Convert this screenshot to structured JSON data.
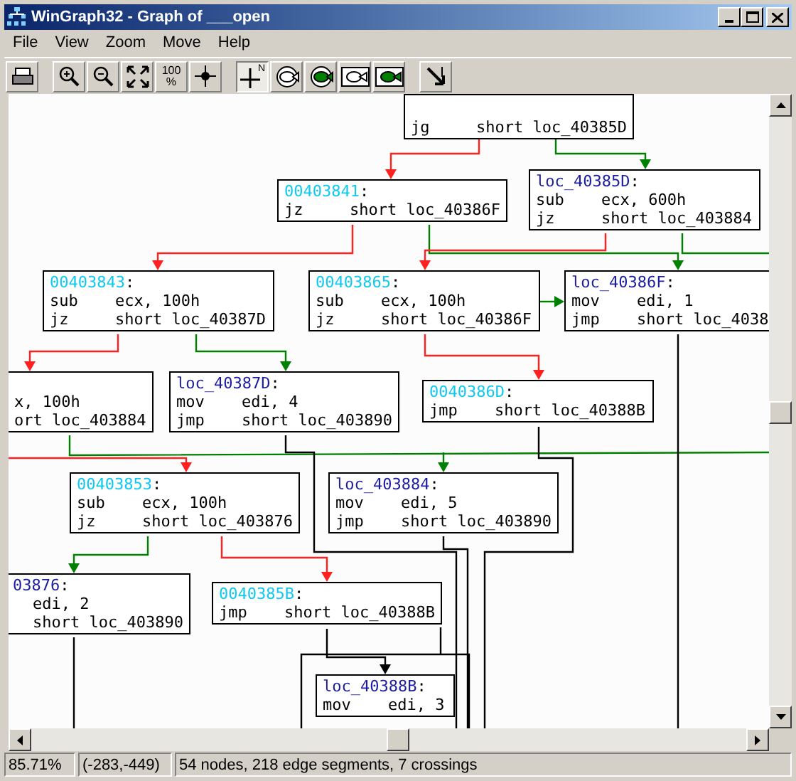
{
  "window": {
    "title": "WinGraph32 - Graph of ___open"
  },
  "menu": [
    "File",
    "View",
    "Zoom",
    "Move",
    "Help"
  ],
  "toolbar": [
    {
      "kind": "print"
    },
    {
      "kind": "sep"
    },
    {
      "kind": "zoom-in"
    },
    {
      "kind": "zoom-out"
    },
    {
      "kind": "fit"
    },
    {
      "kind": "zoom-100",
      "label": "100",
      "sub": "%"
    },
    {
      "kind": "center"
    },
    {
      "kind": "sep"
    },
    {
      "kind": "north",
      "label": "N",
      "pressed": true
    },
    {
      "kind": "fish-outline"
    },
    {
      "kind": "fish-green"
    },
    {
      "kind": "fish-outline-box"
    },
    {
      "kind": "fish-green-box"
    },
    {
      "kind": "sep"
    },
    {
      "kind": "follow"
    }
  ],
  "nodes": [
    {
      "lines": [
        {
          "op": "jg",
          "args": "short loc_40385D"
        }
      ]
    },
    {
      "header": {
        "name": "00403841",
        "punct": ":",
        "kind": "address"
      },
      "lines": [
        {
          "op": "jz",
          "args": "short loc_40386F"
        }
      ]
    },
    {
      "header": {
        "name": "loc_40385D",
        "punct": ":",
        "kind": "label"
      },
      "lines": [
        {
          "op": "sub",
          "args": "ecx, 600h"
        },
        {
          "op": "jz",
          "args": "short loc_403884"
        }
      ]
    },
    {
      "header": {
        "name": "00403843",
        "punct": ":",
        "kind": "address"
      },
      "lines": [
        {
          "op": "sub",
          "args": "ecx, 100h"
        },
        {
          "op": "jz",
          "args": "short loc_40387D"
        }
      ]
    },
    {
      "header": {
        "name": "00403865",
        "punct": ":",
        "kind": "address"
      },
      "lines": [
        {
          "op": "sub",
          "args": "ecx, 100h"
        },
        {
          "op": "jz",
          "args": "short loc_40386F"
        }
      ]
    },
    {
      "header": {
        "name": "loc_40386F",
        "punct": ":",
        "kind": "label"
      },
      "lines": [
        {
          "op": "mov",
          "args": "edi, 1"
        },
        {
          "op": "jmp",
          "args": "short loc_4038"
        }
      ]
    },
    {
      "lines": [
        {
          "args": "x, 100h"
        },
        {
          "args": "ort loc_403884"
        }
      ]
    },
    {
      "header": {
        "name": "loc_40387D",
        "punct": ":",
        "kind": "label"
      },
      "lines": [
        {
          "op": "mov",
          "args": "edi, 4"
        },
        {
          "op": "jmp",
          "args": "short loc_403890"
        }
      ]
    },
    {
      "header": {
        "name": "0040386D",
        "punct": ":",
        "kind": "address"
      },
      "lines": [
        {
          "op": "jmp",
          "args": "short loc_40388B"
        }
      ]
    },
    {
      "header": {
        "name": "00403853",
        "punct": ":",
        "kind": "address"
      },
      "lines": [
        {
          "op": "sub",
          "args": "ecx, 100h"
        },
        {
          "op": "jz",
          "args": "short loc_403876"
        }
      ]
    },
    {
      "header": {
        "name": "loc_403884",
        "punct": ":",
        "kind": "label"
      },
      "lines": [
        {
          "op": "mov",
          "args": "edi, 5"
        },
        {
          "op": "jmp",
          "args": "short loc_403890"
        }
      ]
    },
    {
      "header": {
        "name": "03876",
        "punct": ":",
        "kind": "label"
      },
      "lines": [
        {
          "args": "edi, 2"
        },
        {
          "args": "short loc_403890"
        }
      ]
    },
    {
      "header": {
        "name": "0040385B",
        "punct": ":",
        "kind": "address"
      },
      "lines": [
        {
          "op": "jmp",
          "args": "short loc_40388B"
        }
      ]
    },
    {
      "header": {
        "name": "loc_40388B",
        "punct": ":",
        "kind": "label"
      },
      "lines": [
        {
          "op": "mov",
          "args": "edi, 3"
        }
      ]
    }
  ],
  "status_bar": {
    "zoom": "85.71%",
    "position": "(-283,-449)",
    "summary": "54 nodes, 218 edge segments, 7 crossings"
  }
}
